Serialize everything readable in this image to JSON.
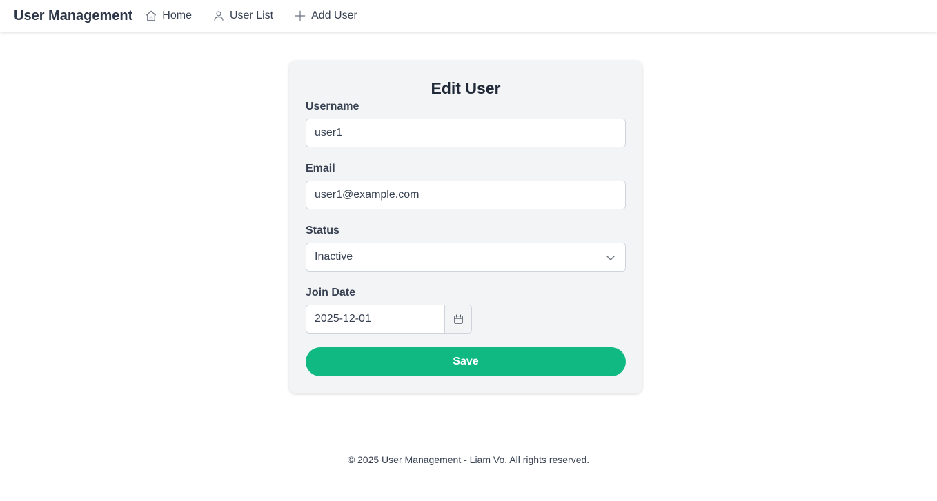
{
  "navbar": {
    "brand": "User Management",
    "links": [
      {
        "label": "Home",
        "icon": "home-icon"
      },
      {
        "label": "User List",
        "icon": "user-icon"
      },
      {
        "label": "Add User",
        "icon": "plus-icon"
      }
    ]
  },
  "form": {
    "title": "Edit User",
    "username": {
      "label": "Username",
      "value": "user1"
    },
    "email": {
      "label": "Email",
      "value": "user1@example.com"
    },
    "status": {
      "label": "Status",
      "value": "Inactive"
    },
    "join_date": {
      "label": "Join Date",
      "value": "2025-12-01"
    },
    "save_label": "Save"
  },
  "footer": {
    "text": "© 2025 User Management - Liam Vo. All rights reserved."
  },
  "colors": {
    "accent": "#10b981",
    "card_bg": "#f3f4f6",
    "text_primary": "#1f2937"
  }
}
